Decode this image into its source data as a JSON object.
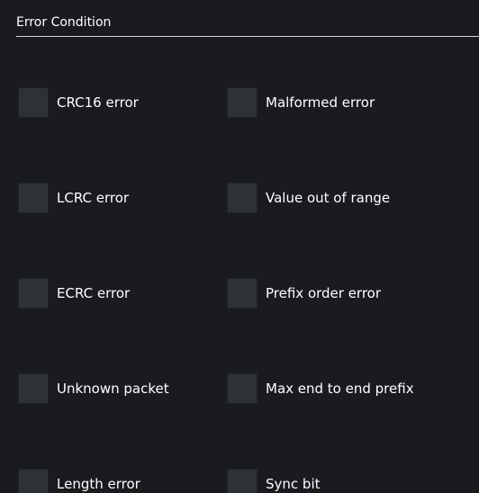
{
  "section": {
    "title": "Error Condition"
  },
  "options": [
    {
      "label": "CRC16 error",
      "checked": false
    },
    {
      "label": "Malformed error",
      "checked": false
    },
    {
      "label": "LCRC error",
      "checked": false
    },
    {
      "label": "Value out of range",
      "checked": false
    },
    {
      "label": "ECRC error",
      "checked": false
    },
    {
      "label": "Prefix order error",
      "checked": false
    },
    {
      "label": "Unknown packet",
      "checked": false
    },
    {
      "label": "Max end to end prefix",
      "checked": false
    },
    {
      "label": "Length error",
      "checked": false
    },
    {
      "label": "Sync bit",
      "checked": false
    }
  ],
  "colors": {
    "background": "#191b1f",
    "checkbox_fill": "#2d3236",
    "text": "#ffffff",
    "rule": "#d6d6d6"
  }
}
